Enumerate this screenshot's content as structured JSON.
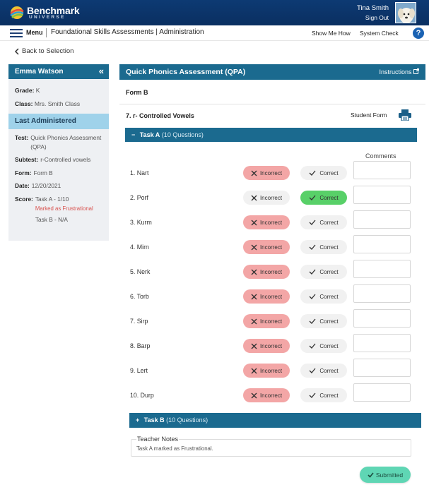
{
  "brand": {
    "name": "Benchmark",
    "sub": "UNIVERSE"
  },
  "user": {
    "name": "Tina Smith",
    "sign_out": "Sign Out"
  },
  "menubar": {
    "menu": "Menu",
    "crumb": "Foundational Skills Assessments | Administration",
    "show_me_how": "Show Me How",
    "system_check": "System Check",
    "help": "?"
  },
  "back": "Back to Selection",
  "student": {
    "name": "Emma Watson",
    "collapse": "«",
    "grade_label": "Grade:",
    "grade": "K",
    "class_label": "Class:",
    "class": "Mrs. Smith Class"
  },
  "last_administered": {
    "heading": "Last Administered",
    "test_label": "Test:",
    "test": "Quick Phonics Assessment (QPA)",
    "subtest_label": "Subtest:",
    "subtest": "r-Controlled vowels",
    "form_label": "Form:",
    "form": "Form B",
    "date_label": "Date:",
    "date": "12/20/2021",
    "score_label": "Score:",
    "score_a": "Task A - 1/10",
    "score_flag": "Marked as Frustrational",
    "score_b": "Task B - N/A"
  },
  "assessment": {
    "title": "Quick Phonics Assessment (QPA)",
    "instructions": "Instructions",
    "form": "Form B",
    "subtest": "7. r- Controlled Vowels",
    "student_form": "Student Form"
  },
  "task_a": {
    "toggle": "−",
    "name": "Task A",
    "count": "(10 Questions)"
  },
  "comments_header": "Comments",
  "buttons": {
    "incorrect": "Incorrect",
    "correct": "Correct"
  },
  "items": [
    {
      "label": "1. Nart",
      "answer": "incorrect"
    },
    {
      "label": "2. Porf",
      "answer": "correct"
    },
    {
      "label": "3. Kurm",
      "answer": "incorrect"
    },
    {
      "label": "4. Mirn",
      "answer": "incorrect"
    },
    {
      "label": "5. Nerk",
      "answer": "incorrect"
    },
    {
      "label": "6. Torb",
      "answer": "incorrect"
    },
    {
      "label": "7. Sirp",
      "answer": "incorrect"
    },
    {
      "label": "8. Barp",
      "answer": "incorrect"
    },
    {
      "label": "9. Lert",
      "answer": "incorrect"
    },
    {
      "label": "10. Durp",
      "answer": "incorrect"
    }
  ],
  "task_b": {
    "toggle": "+",
    "name": "Task B",
    "count": "(10 Questions)"
  },
  "teacher_notes": {
    "label": "Teacher Notes",
    "text": "Task A marked as Frustrational."
  },
  "submit": "Submitted",
  "colors": {
    "header": "#0a2f61",
    "teal": "#1b6a8f",
    "incorrect": "#f3a6a6",
    "correct": "#58d068",
    "submitted": "#5fd6b4",
    "flag": "#d9534f"
  }
}
